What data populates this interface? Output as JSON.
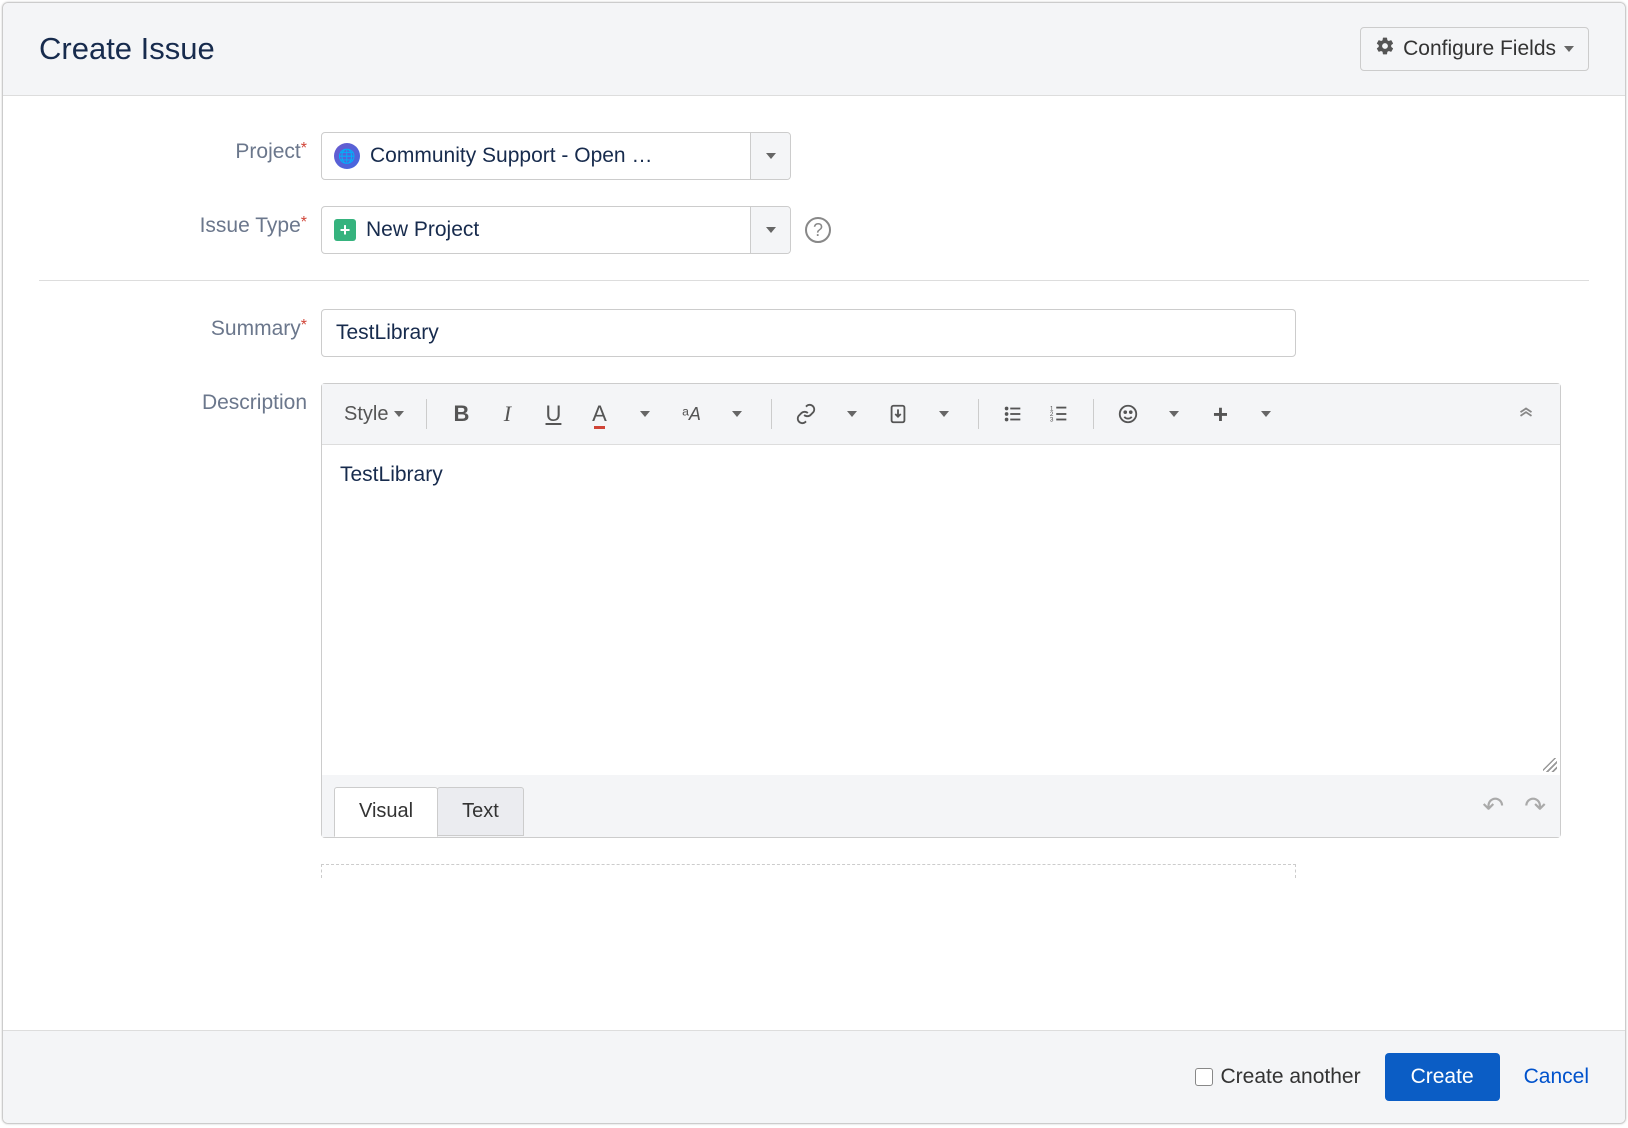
{
  "header": {
    "title": "Create Issue",
    "configure_label": "Configure Fields"
  },
  "form": {
    "project": {
      "label": "Project",
      "value": "Community Support - Open …"
    },
    "issue_type": {
      "label": "Issue Type",
      "value": "New Project"
    },
    "summary": {
      "label": "Summary",
      "value": "TestLibrary"
    },
    "description": {
      "label": "Description",
      "value": "TestLibrary"
    }
  },
  "editor": {
    "style_label": "Style",
    "tabs": {
      "visual": "Visual",
      "text": "Text"
    }
  },
  "footer": {
    "create_another": "Create another",
    "create": "Create",
    "cancel": "Cancel"
  }
}
